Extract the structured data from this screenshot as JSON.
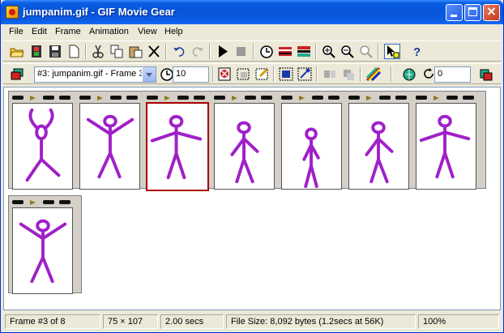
{
  "window": {
    "title": "jumpanim.gif - GIF Movie Gear"
  },
  "menu": [
    "File",
    "Edit",
    "Frame",
    "Animation",
    "View",
    "Help"
  ],
  "toolbar1_icons": [
    "open-icon",
    "filmstrip-icon",
    "save-icon",
    "new-document-icon",
    "cut-icon",
    "copy-icon",
    "paste-icon",
    "delete-icon",
    "undo-icon",
    "redo-icon",
    "play-icon",
    "stop-icon",
    "timing-icon",
    "frame-properties-icon",
    "reduce-colors-icon",
    "zoom-in-icon",
    "zoom-out-icon",
    "zoom-reset-icon",
    "select-tool-icon",
    "help-icon"
  ],
  "toolbar2": {
    "frame_selector": "#3: jumpanim.gif - Frame 3",
    "delay_value": "10",
    "loop_value": "0"
  },
  "colors": {
    "figure": "#a020c8",
    "selection": "#a00000"
  },
  "frames": [
    {
      "pose": "arms-up-round"
    },
    {
      "pose": "jump-wide"
    },
    {
      "pose": "arms-out"
    },
    {
      "pose": "arms-low"
    },
    {
      "pose": "standing"
    },
    {
      "pose": "arms-low"
    },
    {
      "pose": "arms-out"
    },
    {
      "pose": "jump-wide"
    }
  ],
  "status": {
    "frame": "Frame #3 of 8",
    "size": "75 × 107",
    "duration": "2.00 secs",
    "filesize": "File Size: 8,092 bytes  (1.2secs at 56K)",
    "zoom": "100%"
  }
}
